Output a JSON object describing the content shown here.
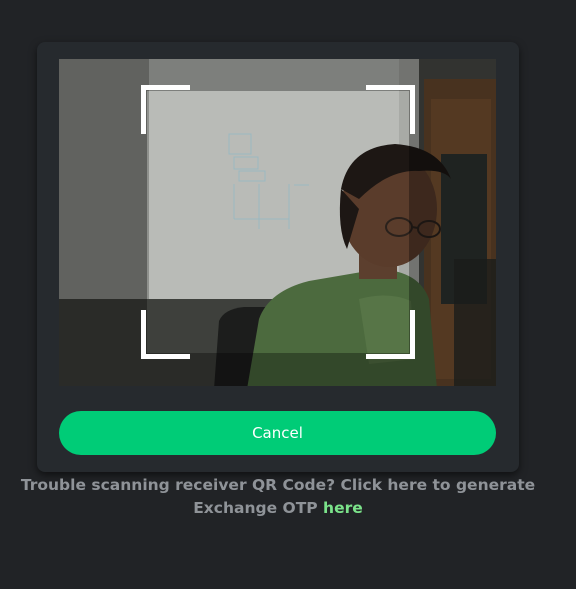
{
  "scanner": {
    "cancel_label": "Cancel"
  },
  "help": {
    "text": "Trouble scanning receiver QR Code? Click here to generate Exchange OTP",
    "link_label": "here",
    "link_color": "#7be38a"
  },
  "colors": {
    "background": "#212326",
    "card": "#262a2e",
    "accent": "#00cc77"
  },
  "icons": [
    "scan-frame-corners"
  ]
}
